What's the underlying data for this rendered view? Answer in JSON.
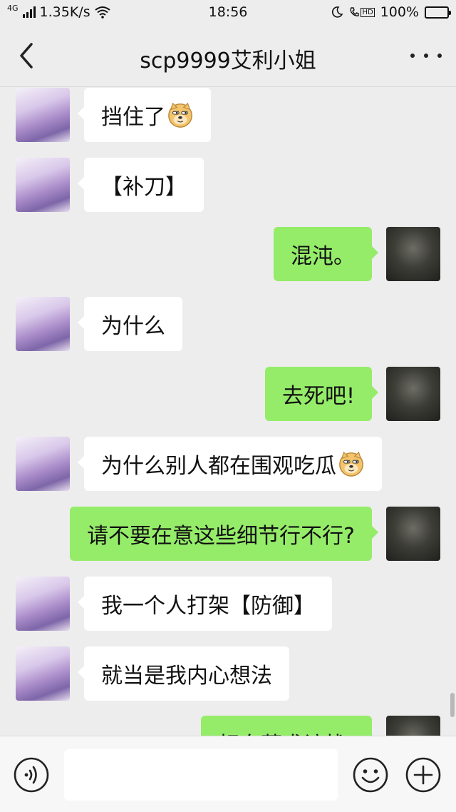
{
  "status_bar": {
    "network": "4G",
    "speed": "1.35K/s",
    "time": "18:56",
    "hd_label": "HD",
    "battery": "100%"
  },
  "header": {
    "title": "scp9999艾利小姐"
  },
  "messages": [
    {
      "side": "in",
      "text": "挡住了",
      "emoji": "doge"
    },
    {
      "side": "in",
      "text": "【补刀】"
    },
    {
      "side": "out",
      "text": "混沌。"
    },
    {
      "side": "in",
      "text": "为什么"
    },
    {
      "side": "out",
      "text": "去死吧!"
    },
    {
      "side": "in",
      "text": "为什么别人都在围观吃瓜",
      "emoji": "doge"
    },
    {
      "side": "out",
      "text": "请不要在意这些细节行不行?"
    },
    {
      "side": "in",
      "text": "我一个人打架【防御】"
    },
    {
      "side": "in",
      "text": "就当是我内心想法"
    },
    {
      "side": "out",
      "text": "相向莫求访栈!"
    }
  ],
  "input": {
    "value": "",
    "placeholder": ""
  },
  "colors": {
    "background": "#ededed",
    "incoming_bubble": "#ffffff",
    "outgoing_bubble": "#95ec69"
  }
}
